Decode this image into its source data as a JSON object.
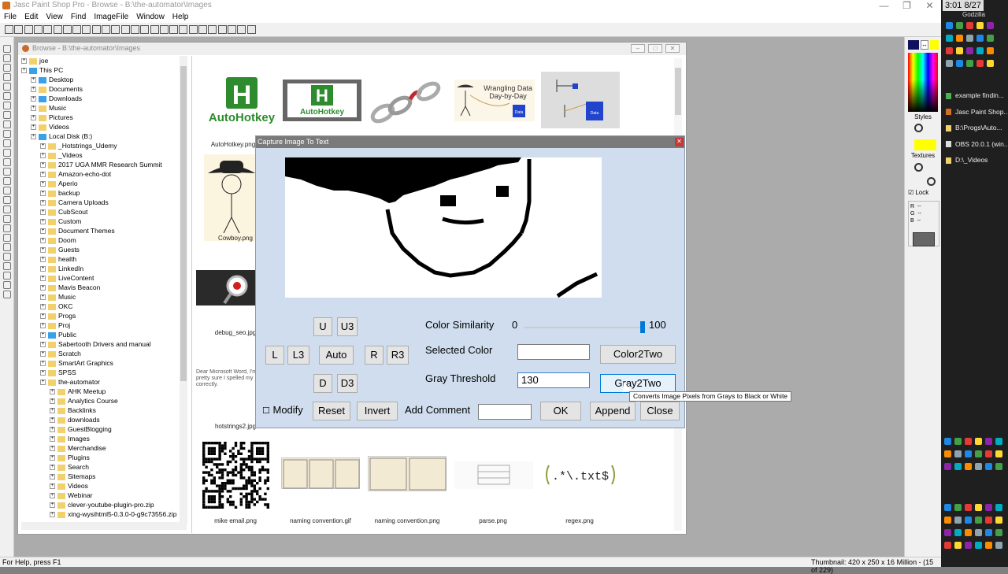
{
  "window": {
    "title": "Jasc Paint Shop Pro - Browse - B:\\the-automator\\Images"
  },
  "menu": [
    "File",
    "Edit",
    "View",
    "Find",
    "ImageFile",
    "Window",
    "Help"
  ],
  "browse": {
    "title": "Browse - B:\\the-automator\\Images",
    "tree": [
      {
        "label": "joe",
        "indent": 0,
        "icon": "user"
      },
      {
        "label": "This PC",
        "indent": 0,
        "icon": "pc"
      },
      {
        "label": "Desktop",
        "indent": 1,
        "icon": "blue"
      },
      {
        "label": "Documents",
        "indent": 1,
        "icon": "folder"
      },
      {
        "label": "Downloads",
        "indent": 1,
        "icon": "blue"
      },
      {
        "label": "Music",
        "indent": 1,
        "icon": "folder"
      },
      {
        "label": "Pictures",
        "indent": 1,
        "icon": "folder"
      },
      {
        "label": "Videos",
        "indent": 1,
        "icon": "folder"
      },
      {
        "label": "Local Disk (B:)",
        "indent": 1,
        "icon": "drive"
      },
      {
        "label": "_Hotstrings_Udemy",
        "indent": 2,
        "icon": "folder"
      },
      {
        "label": "_Videos",
        "indent": 2,
        "icon": "folder"
      },
      {
        "label": "2017 UGA MMR Research Summit",
        "indent": 2,
        "icon": "folder"
      },
      {
        "label": "Amazon-echo-dot",
        "indent": 2,
        "icon": "folder"
      },
      {
        "label": "Aperio",
        "indent": 2,
        "icon": "folder"
      },
      {
        "label": "backup",
        "indent": 2,
        "icon": "folder"
      },
      {
        "label": "Camera Uploads",
        "indent": 2,
        "icon": "folder"
      },
      {
        "label": "CubScout",
        "indent": 2,
        "icon": "folder"
      },
      {
        "label": "Custom",
        "indent": 2,
        "icon": "folder"
      },
      {
        "label": "Document Themes",
        "indent": 2,
        "icon": "folder"
      },
      {
        "label": "Doom",
        "indent": 2,
        "icon": "folder"
      },
      {
        "label": "Guests",
        "indent": 2,
        "icon": "folder"
      },
      {
        "label": "health",
        "indent": 2,
        "icon": "folder"
      },
      {
        "label": "LinkedIn",
        "indent": 2,
        "icon": "folder"
      },
      {
        "label": "LiveContent",
        "indent": 2,
        "icon": "folder"
      },
      {
        "label": "Mavis Beacon",
        "indent": 2,
        "icon": "folder"
      },
      {
        "label": "Music",
        "indent": 2,
        "icon": "folder"
      },
      {
        "label": "OKC",
        "indent": 2,
        "icon": "folder"
      },
      {
        "label": "Progs",
        "indent": 2,
        "icon": "folder"
      },
      {
        "label": "Proj",
        "indent": 2,
        "icon": "folder"
      },
      {
        "label": "Public",
        "indent": 2,
        "icon": "blue"
      },
      {
        "label": "Sabertooth Drivers and manual",
        "indent": 2,
        "icon": "folder"
      },
      {
        "label": "Scratch",
        "indent": 2,
        "icon": "folder"
      },
      {
        "label": "SmartArt Graphics",
        "indent": 2,
        "icon": "folder"
      },
      {
        "label": "SPSS",
        "indent": 2,
        "icon": "folder"
      },
      {
        "label": "the-automator",
        "indent": 2,
        "icon": "folder"
      },
      {
        "label": "AHK Meetup",
        "indent": 3,
        "icon": "folder"
      },
      {
        "label": "Analytics Course",
        "indent": 3,
        "icon": "folder"
      },
      {
        "label": "Backlinks",
        "indent": 3,
        "icon": "folder"
      },
      {
        "label": "downloads",
        "indent": 3,
        "icon": "folder"
      },
      {
        "label": "GuestBlogging",
        "indent": 3,
        "icon": "folder"
      },
      {
        "label": "Images",
        "indent": 3,
        "icon": "folder"
      },
      {
        "label": "Merchandise",
        "indent": 3,
        "icon": "folder"
      },
      {
        "label": "Plugins",
        "indent": 3,
        "icon": "folder"
      },
      {
        "label": "Search",
        "indent": 3,
        "icon": "folder"
      },
      {
        "label": "Sitemaps",
        "indent": 3,
        "icon": "folder"
      },
      {
        "label": "Videos",
        "indent": 3,
        "icon": "folder"
      },
      {
        "label": "Webinar",
        "indent": 3,
        "icon": "folder"
      },
      {
        "label": "clever-youtube-plugin-pro.zip",
        "indent": 3,
        "icon": "zip"
      },
      {
        "label": "xing-wysihtml5-0.3.0-0-g9c73556.zip",
        "indent": 3,
        "icon": "zip"
      }
    ],
    "thumbs_top": [
      {
        "caption": "AutoHotkey.png",
        "kind": "ahk-big"
      },
      {
        "caption": "",
        "kind": "ahk-small"
      },
      {
        "caption": "",
        "kind": "chain"
      },
      {
        "caption": "",
        "kind": "wrangling"
      },
      {
        "caption": "",
        "kind": "data-sketch"
      }
    ],
    "wrangling_text": [
      "Wrangling Data",
      "Day-by-Day"
    ],
    "data_label": "Data",
    "ahk_text": "AutoHotkey",
    "thumbs_left": [
      {
        "caption": "Cowboy.png"
      },
      {
        "caption": "debug_seo.jpg"
      },
      {
        "caption": "hotstrings2.jpg"
      }
    ],
    "hotstrings_snippet": "Dear Microsoft Word, I'm pretty sure I spelled my correctly.",
    "thumbs_bottom": [
      {
        "caption": "mike email.png"
      },
      {
        "caption": "naming convention.gif"
      },
      {
        "caption": "naming convention.png"
      },
      {
        "caption": "parse.png"
      },
      {
        "caption": "regex.png"
      }
    ],
    "regex_text": ".*\\.txt$"
  },
  "dialog": {
    "title": "Capture Image To Text",
    "buttons": {
      "u": "U",
      "u3": "U3",
      "l": "L",
      "l3": "L3",
      "auto": "Auto",
      "r": "R",
      "r3": "R3",
      "d": "D",
      "d3": "D3",
      "reset": "Reset",
      "invert": "Invert",
      "ok": "OK",
      "append": "Append",
      "close": "Close",
      "color2two": "Color2Two",
      "gray2two": "Gray2Two"
    },
    "color_similarity": {
      "label": "Color Similarity",
      "min": "0",
      "max": "100",
      "value": 100
    },
    "selected_color": {
      "label": "Selected  Color",
      "value": ""
    },
    "gray_threshold": {
      "label": "Gray Threshold",
      "value": "130"
    },
    "modify": {
      "label": "Modify",
      "checked": false
    },
    "add_comment": {
      "label": "Add Comment",
      "value": ""
    },
    "tooltip": "Converts Image Pixels from Grays to Black or White"
  },
  "statusbar": {
    "left": "For Help, press F1",
    "right": "Thumbnail: 420 x 250 x 16 Million - (15 of 229)"
  },
  "rpanel": {
    "styles": "Styles",
    "textures": "Textures",
    "lock": "Lock",
    "r": "R",
    "g": "G",
    "b": "B",
    "dash": "--"
  },
  "taskbar": {
    "clock": "3:01 8/27",
    "user": "Godzilla",
    "items": [
      {
        "label": "example findin...",
        "color": "#4caf50"
      },
      {
        "label": "Jasc Paint Shop...",
        "color": "#d07020"
      },
      {
        "label": "B:\\Progs\\Auto...",
        "color": "#f2d06b"
      },
      {
        "label": "OBS 20.0.1 (win...",
        "color": "#dddddd"
      },
      {
        "label": "D:\\_Videos",
        "color": "#f2d06b"
      }
    ]
  }
}
